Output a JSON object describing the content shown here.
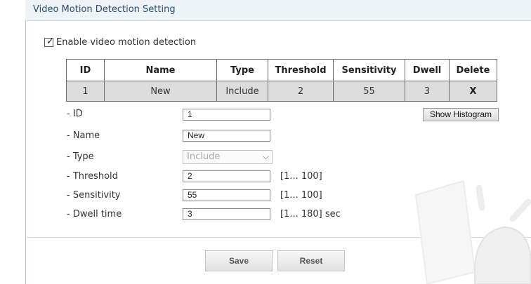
{
  "header": {
    "title": "Video Motion Detection Setting"
  },
  "enable": {
    "label": "Enable video motion detection",
    "checked": true
  },
  "table": {
    "columns": [
      "ID",
      "Name",
      "Type",
      "Threshold",
      "Sensitivity",
      "Dwell",
      "Delete"
    ],
    "rows": [
      {
        "id": "1",
        "name": "New",
        "type": "Include",
        "threshold": "2",
        "sensitivity": "55",
        "dwell": "3",
        "delete": "X"
      }
    ]
  },
  "form": {
    "id": {
      "label": "- ID",
      "value": "1"
    },
    "name": {
      "label": "- Name",
      "value": "New"
    },
    "type": {
      "label": "- Type",
      "value": "Include",
      "disabled": true
    },
    "threshold": {
      "label": "- Threshold",
      "value": "2",
      "range": "[1... 100]"
    },
    "sensitivity": {
      "label": "- Sensitivity",
      "value": "55",
      "range": "[1... 100]"
    },
    "dwell": {
      "label": "- Dwell time",
      "value": "3",
      "range": "[1... 180] sec"
    }
  },
  "buttons": {
    "histogram": "Show Histogram",
    "save": "Save",
    "reset": "Reset"
  },
  "icons": {
    "checkbox": "check-icon",
    "select_chevron": "chevron-down-icon",
    "decoration": "lamp-watermark-icon"
  },
  "colors": {
    "title": "#2a4c76",
    "titlebar_bg": "#eef3f8",
    "row_bg": "#dcdcdc"
  }
}
